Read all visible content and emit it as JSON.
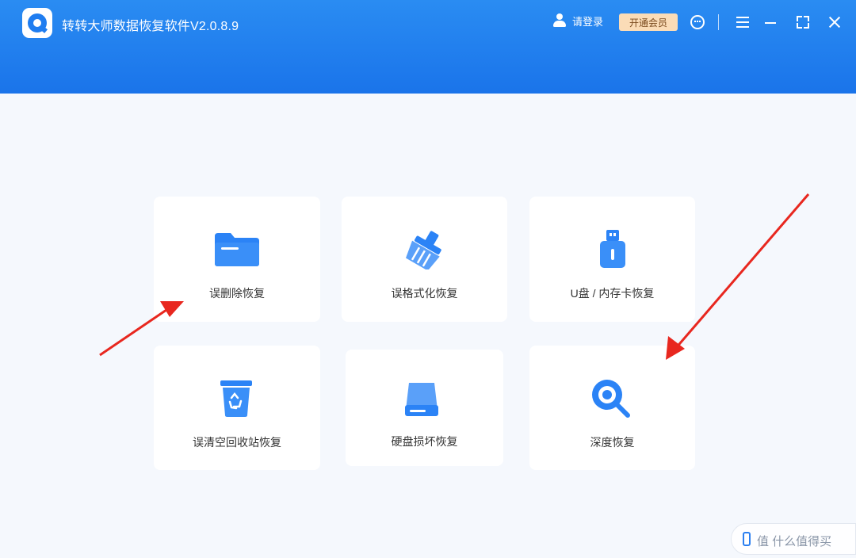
{
  "app": {
    "title": "转转大师数据恢复软件V2.0.8.9"
  },
  "header": {
    "login_label": "请登录",
    "vip_label": "开通会员",
    "accent_color": "#1f7df0",
    "icons": [
      "user-icon",
      "customer-service-icon",
      "menu-icon",
      "minimize-icon",
      "maximize-icon",
      "close-icon"
    ]
  },
  "cards": [
    {
      "label": "误删除恢复",
      "icon": "folder-icon"
    },
    {
      "label": "误格式化恢复",
      "icon": "broom-icon"
    },
    {
      "label": "U盘 / 内存卡恢复",
      "icon": "usb-drive-icon"
    },
    {
      "label": "误清空回收站恢复",
      "icon": "recycle-bin-icon"
    },
    {
      "label": "硬盘损坏恢复",
      "icon": "hard-disk-icon"
    },
    {
      "label": "深度恢复",
      "icon": "deep-scan-icon"
    }
  ],
  "annotations": {
    "arrow_color": "#e8271f"
  },
  "watermark": {
    "text": "值 什么值得买"
  }
}
